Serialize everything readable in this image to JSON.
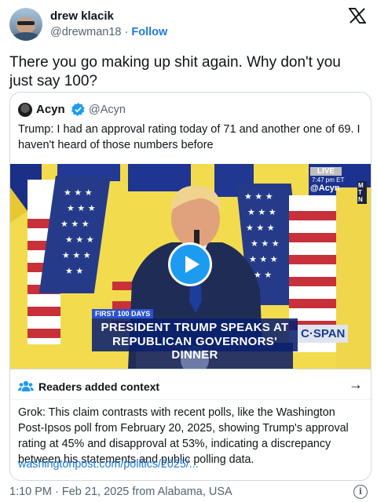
{
  "author": {
    "display_name": "drew klacik",
    "handle": "@drewman18",
    "separator": "·",
    "follow_label": "Follow"
  },
  "tweet": {
    "text": "There you go making up shit again. Why don't you just say 100?"
  },
  "quoted": {
    "display_name": "Acyn",
    "handle": "@Acyn",
    "text": "Trump: I had an approval rating today of 71 and another one of 69. I haven't heard of those numbers before",
    "video": {
      "live_badge": "LIVE",
      "live_time": "7:47 pm ET",
      "watermark": "@Acyn",
      "network_corner": "MTN",
      "banner_top": "FIRST 100 DAYS",
      "banner_line1": "PRESIDENT TRUMP SPEAKS AT",
      "banner_line2": "REPUBLICAN GOVERNORS' DINNER",
      "network_logo": "C·SPAN",
      "play_icon": "play-icon"
    }
  },
  "context": {
    "title": "Readers added context",
    "body": "Grok: This claim contrasts with recent polls, like the Washington Post-Ipsos poll from February 20, 2025, showing Trump's approval rating at 45% and disapproval at 53%, indicating a discrepancy between his statements and public polling data.",
    "link": "washingtonpost.com/politics/2025/..."
  },
  "footer": {
    "timestamp": "1:10 PM · Feb 21, 2025 from Alabama, USA",
    "info_icon": "i"
  },
  "colors": {
    "link": "#1d7bd8",
    "muted": "#536471",
    "verified": "#1d9bf0",
    "border": "#cfd9de"
  }
}
